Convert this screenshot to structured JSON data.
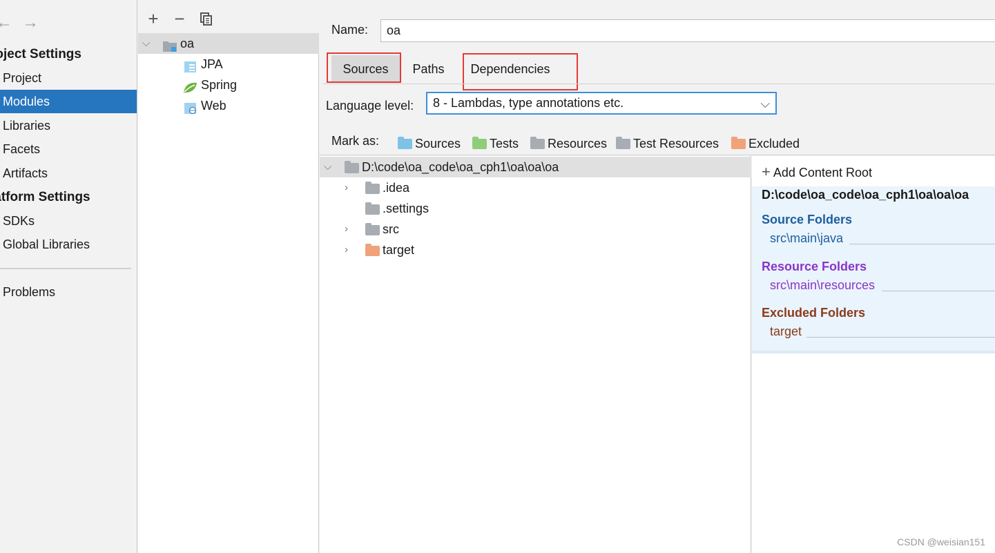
{
  "left_panel": {
    "section_project": "roject Settings",
    "project_items": [
      "Project",
      "Modules",
      "Libraries",
      "Facets",
      "Artifacts"
    ],
    "section_platform": "latform Settings",
    "platform_items": [
      "SDKs",
      "Global Libraries"
    ],
    "problems": "Problems",
    "selected_index": 1
  },
  "module_tree": {
    "root": "oa",
    "facets": [
      "JPA",
      "Spring",
      "Web"
    ]
  },
  "module": {
    "name_label": "Name:",
    "name_value": "oa",
    "tabs": [
      "Sources",
      "Paths",
      "Dependencies"
    ],
    "active_tab": "Sources",
    "language_label": "Language level:",
    "language_value": "8 - Lambdas, type annotations etc.",
    "mark_as_label": "Mark as:",
    "mark_as": [
      {
        "label": "Sources",
        "color": "#7ec3e6"
      },
      {
        "label": "Tests",
        "color": "#8fcd7a"
      },
      {
        "label": "Resources",
        "color": "#a7adb3"
      },
      {
        "label": "Test Resources",
        "color": "#a7adb3"
      },
      {
        "label": "Excluded",
        "color": "#f0a27a"
      }
    ]
  },
  "file_tree": {
    "root": "D:\\code\\oa_code\\oa_cph1\\oa\\oa\\oa",
    "children": [
      ".idea",
      ".settings",
      "src",
      "target"
    ]
  },
  "content_root": {
    "add_label": "Add Content Root",
    "path": "D:\\code\\oa_code\\oa_cph1\\oa\\oa\\oa",
    "source_title": "Source Folders",
    "source_entry": "src\\main\\java",
    "resource_title": "Resource Folders",
    "resource_entry": "src\\main\\resources",
    "excluded_title": "Excluded Folders",
    "excluded_entry": "target"
  },
  "colors": {
    "selected": "#2675bf",
    "source": "#1d5fa0",
    "resource": "#8a35c9",
    "excluded": "#8b3a1c",
    "highlight": "#e53935"
  },
  "watermark": "CSDN @weisian151"
}
